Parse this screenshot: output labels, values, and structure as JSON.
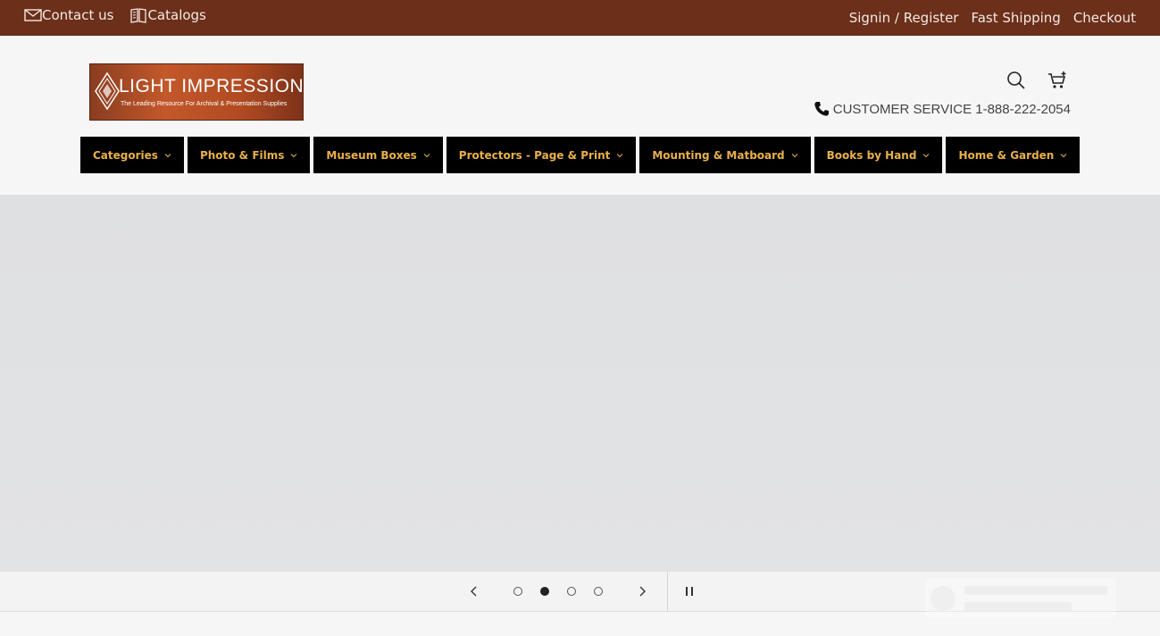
{
  "topbar": {
    "contact_label": "Contact us",
    "catalogs_label": "Catalogs",
    "signin_label": "Signin / Register",
    "shipping_label": "Fast Shipping",
    "checkout_label": "Checkout",
    "bg_color": "#6b2f1a"
  },
  "header": {
    "logo": {
      "brand": "LIGHT IMPRESSIONS",
      "registered": "®",
      "tagline": "The Leading Resource For Archival & Presentation Supplies"
    },
    "customer_service": "CUSTOMER SERVICE 1-888-222-2054",
    "icons": [
      "search-icon",
      "cart-icon",
      "phone-icon"
    ]
  },
  "nav": {
    "text_color": "#e8b04a",
    "bg_color": "#000000",
    "items": [
      {
        "label": "Categories"
      },
      {
        "label": "Photo & Films"
      },
      {
        "label": "Museum Boxes"
      },
      {
        "label": "Protectors - Page & Print"
      },
      {
        "label": "Mounting & Matboard"
      },
      {
        "label": "Books by Hand"
      },
      {
        "label": "Home & Garden"
      }
    ]
  },
  "slideshow": {
    "slide_count": 4,
    "active_slide": 2
  }
}
